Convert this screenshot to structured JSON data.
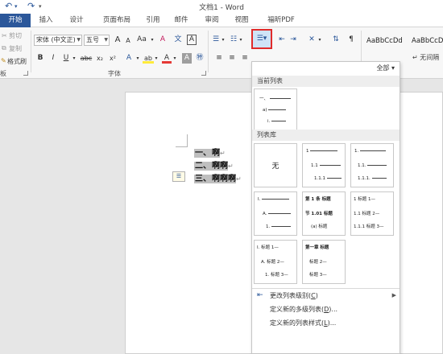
{
  "window": {
    "title": "文档1 - Word"
  },
  "tabs": [
    "开始",
    "插入",
    "设计",
    "页面布局",
    "引用",
    "邮件",
    "审阅",
    "视图",
    "福昕PDF"
  ],
  "ribbon": {
    "clipboard": {
      "cut": "剪切",
      "copy": "复制",
      "painter": "格式刷",
      "label": "板"
    },
    "font": {
      "family": "宋体 (中文正)",
      "size": "五号",
      "grow": "A",
      "shrink": "A",
      "change_case": "Aa",
      "clear": "A",
      "wen": "文",
      "bold": "B",
      "italic": "I",
      "underline": "U",
      "strike": "abc",
      "subscript": "x₂",
      "superscript": "x²",
      "effects": "A",
      "highlight": "ab",
      "color": "A",
      "shading": "A",
      "border_char": "A",
      "label": "字体"
    },
    "styles": {
      "items": [
        "AaBbCcDd",
        "AaBbCcDd"
      ],
      "no_spacing": "无间隔"
    }
  },
  "panel": {
    "filter": "全部",
    "current_header": "当前列表",
    "library_header": "列表库",
    "none_label": "无",
    "current_list": {
      "lines": [
        "一、",
        "a)",
        "i."
      ]
    },
    "library": [
      {
        "rows": [
          "1",
          "1.1",
          "1.1.1"
        ]
      },
      {
        "rows": [
          "1.",
          "1.1.",
          "1.1.1."
        ]
      },
      {
        "rows": [
          "I.",
          "A.",
          "1."
        ]
      },
      {
        "rows": [
          "第 1 条 标题",
          "节 1.01 标题",
          "(a) 标题"
        ]
      },
      {
        "rows": [
          "1 标题 1—",
          "1.1 标题 2—",
          "1.1.1 标题 3—"
        ]
      },
      {
        "rows": [
          "I. 标题 1—",
          "A. 标题 2—",
          "1. 标题 3—"
        ]
      },
      {
        "rows": [
          "第一章 标题",
          "标题 2—",
          "标题 3—"
        ]
      }
    ],
    "menu": [
      {
        "label": "更改列表级别(",
        "key": "C",
        "tail": ")"
      },
      {
        "label": "定义新的多级列表(",
        "key": "D",
        "tail": ")..."
      },
      {
        "label": "定义新的列表样式(",
        "key": "L",
        "tail": ")..."
      }
    ]
  },
  "document": {
    "lines": [
      {
        "num": "一、",
        "text": "啊"
      },
      {
        "num": "二、",
        "text": "啊啊"
      },
      {
        "num": "三、",
        "text": "啊啊啊"
      }
    ],
    "paragraph_mark": "↵"
  },
  "colors": {
    "accent": "#2b579a",
    "highlight_red": "#d32f2f"
  }
}
